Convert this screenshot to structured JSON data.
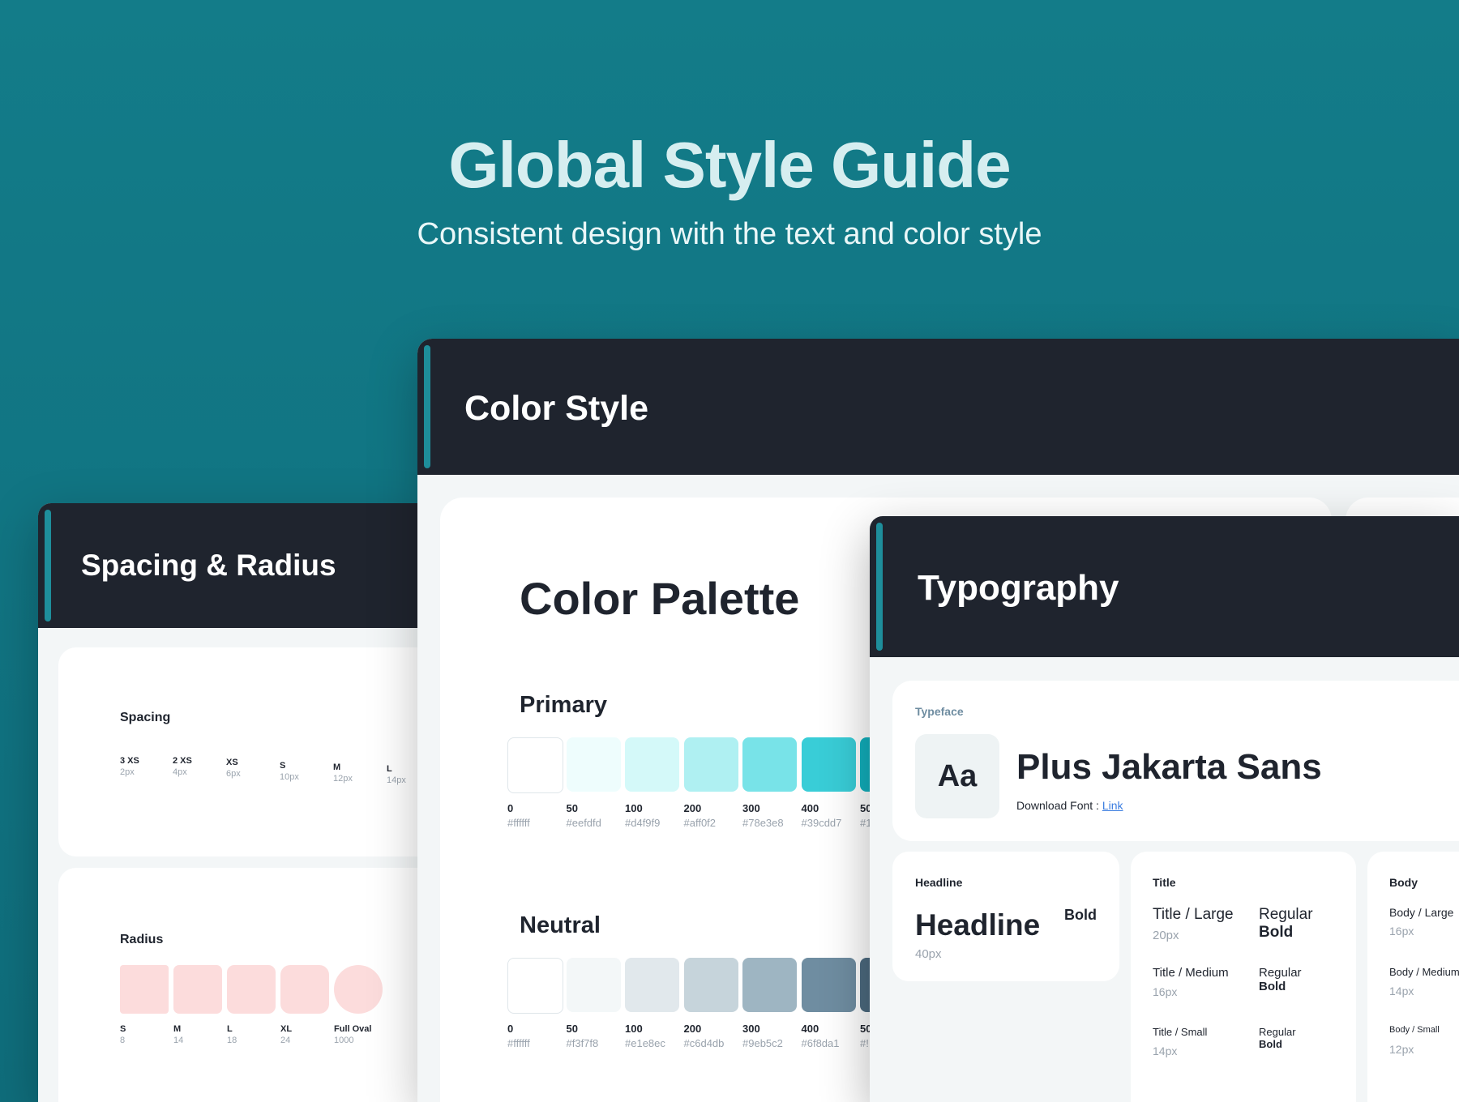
{
  "hero": {
    "title": "Global Style Guide",
    "subtitle": "Consistent design with the text and color  style"
  },
  "spacing_radius": {
    "title": "Spacing & Radius",
    "spacing_heading": "Spacing",
    "spacing_items": [
      {
        "label": "3 XS",
        "value": "2px"
      },
      {
        "label": "2 XS",
        "value": "4px"
      },
      {
        "label": "XS",
        "value": "6px"
      },
      {
        "label": "S",
        "value": "10px"
      },
      {
        "label": "M",
        "value": "12px"
      },
      {
        "label": "L",
        "value": "14px"
      }
    ],
    "radius_heading": "Radius",
    "radius_items": [
      {
        "label": "S",
        "value": "8"
      },
      {
        "label": "M",
        "value": "14"
      },
      {
        "label": "L",
        "value": "18"
      },
      {
        "label": "XL",
        "value": "24"
      },
      {
        "label": "Full Oval",
        "value": "1000"
      }
    ],
    "radius_color": "#fcdcdc"
  },
  "color_style": {
    "title": "Color Style",
    "palette_title": "Color Palette",
    "primary": {
      "label": "Primary",
      "swatches": [
        {
          "step": "0",
          "hex": "#ffffff"
        },
        {
          "step": "50",
          "hex": "#eefdfd"
        },
        {
          "step": "100",
          "hex": "#d4f9f9"
        },
        {
          "step": "200",
          "hex": "#aff0f2"
        },
        {
          "step": "300",
          "hex": "#78e3e8"
        },
        {
          "step": "400",
          "hex": "#39cdd7"
        },
        {
          "step": "50",
          "hex": "#1"
        }
      ]
    },
    "neutral": {
      "label": "Neutral",
      "swatches": [
        {
          "step": "0",
          "hex": "#ffffff"
        },
        {
          "step": "50",
          "hex": "#f3f7f8"
        },
        {
          "step": "100",
          "hex": "#e1e8ec"
        },
        {
          "step": "200",
          "hex": "#c6d4db"
        },
        {
          "step": "300",
          "hex": "#9eb5c2"
        },
        {
          "step": "400",
          "hex": "#6f8da1"
        },
        {
          "step": "50",
          "hex": "#!"
        }
      ]
    }
  },
  "typography": {
    "title": "Typography",
    "typeface_label": "Typeface",
    "aa": "Aa",
    "font_name": "Plus Jakarta Sans",
    "download_label": "Download Font : ",
    "download_link": "Link",
    "headline": {
      "heading": "Headline",
      "sample": "Headline",
      "weight": "Bold",
      "size": "40px"
    },
    "title_card": {
      "heading": "Title",
      "rows": [
        {
          "name": "Title / Large",
          "size": "20px",
          "w1": "Regular",
          "w2": "Bold"
        },
        {
          "name": "Title / Medium",
          "size": "16px",
          "w1": "Regular",
          "w2": "Bold"
        },
        {
          "name": "Title / Small",
          "size": "14px",
          "w1": "Regular",
          "w2": "Bold"
        }
      ]
    },
    "body_card": {
      "heading": "Body",
      "rows": [
        {
          "name": "Body / Large",
          "size": "16px"
        },
        {
          "name": "Body / Medium",
          "size": "14px"
        },
        {
          "name": "Body / Small",
          "size": "12px"
        }
      ]
    }
  }
}
